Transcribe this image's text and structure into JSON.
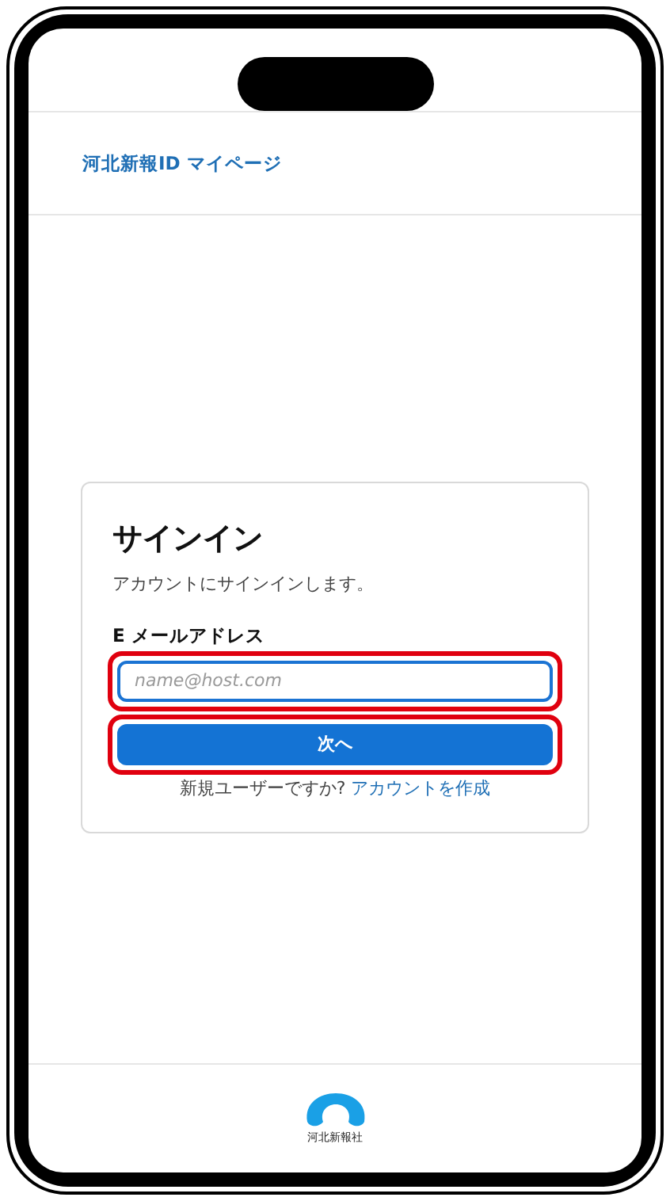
{
  "header": {
    "title": "河北新報ID マイページ"
  },
  "signin": {
    "title": "サインイン",
    "subtitle": "アカウントにサインインします。",
    "email_label": "E メールアドレス",
    "email_field": {
      "placeholder": "name@host.com",
      "highlighted": true
    },
    "next_button": {
      "label": "次へ",
      "highlighted": true
    },
    "signup_prompt": "新規ユーザーですか?",
    "signup_link": "アカウントを作成"
  },
  "footer": {
    "logo_text": "河北新報社"
  }
}
